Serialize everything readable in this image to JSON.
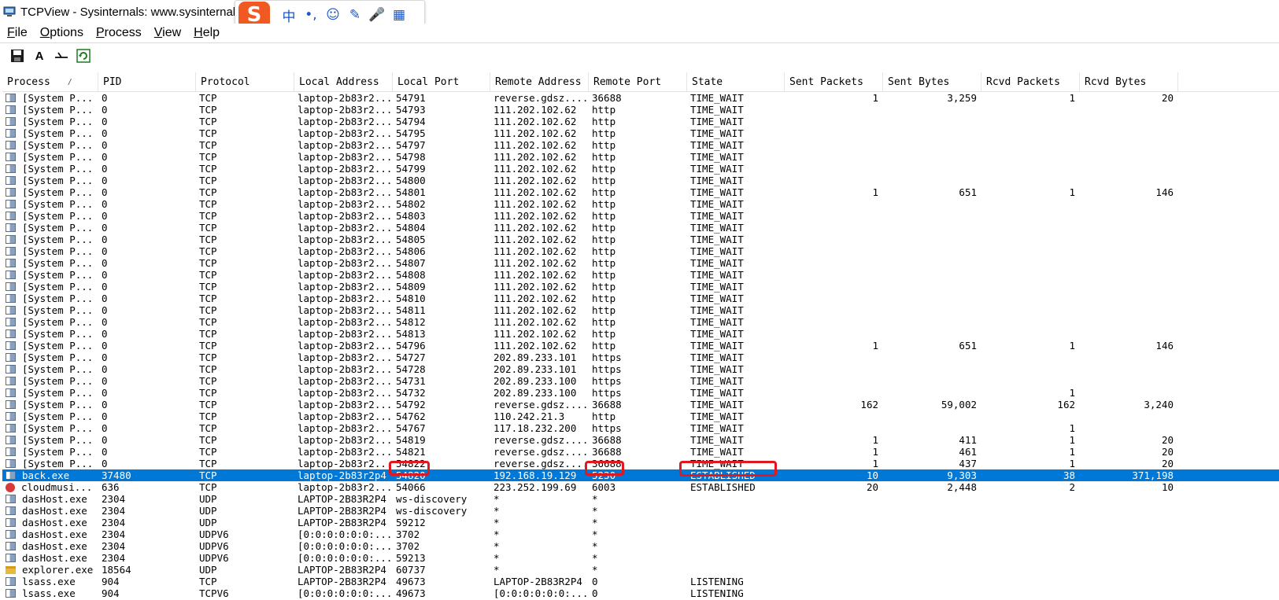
{
  "window": {
    "title": "TCPView - Sysinternals: www.sysinternals.com"
  },
  "ime": {
    "logo": "S",
    "buttons": [
      {
        "name": "chinese-mode-icon",
        "glyph": "中"
      },
      {
        "name": "punctuation-icon",
        "glyph": "•,"
      },
      {
        "name": "emoji-icon",
        "glyph": "☺"
      },
      {
        "name": "handwriting-icon",
        "glyph": "✎"
      },
      {
        "name": "microphone-icon",
        "glyph": "🎤"
      },
      {
        "name": "toolbox-icon",
        "glyph": "▦"
      }
    ]
  },
  "menu": [
    {
      "m": "F",
      "rest": "ile"
    },
    {
      "m": "O",
      "rest": "ptions"
    },
    {
      "m": "P",
      "rest": "rocess"
    },
    {
      "m": "V",
      "rest": "iew"
    },
    {
      "m": "H",
      "rest": "elp"
    }
  ],
  "toolbar": {
    "save_glyph": "💾",
    "font_glyph": "A",
    "connect_glyph": "⤙",
    "refresh_glyph": "⟳"
  },
  "columns": [
    "Process",
    "PID",
    "Protocol",
    "Local Address",
    "Local Port",
    "Remote Address",
    "Remote Port",
    "State",
    "Sent Packets",
    "Sent Bytes",
    "Rcvd Packets",
    "Rcvd Bytes"
  ],
  "sort_indicator": "/",
  "rows": [
    {
      "icon": "std",
      "c": [
        "[System P...",
        "0",
        "TCP",
        "laptop-2b83r2...",
        "54791",
        "reverse.gdsz....",
        "36688",
        "TIME_WAIT",
        "1",
        "3,259",
        "1",
        "20"
      ]
    },
    {
      "icon": "std",
      "c": [
        "[System P...",
        "0",
        "TCP",
        "laptop-2b83r2...",
        "54793",
        "111.202.102.62",
        "http",
        "TIME_WAIT",
        "",
        "",
        "",
        ""
      ]
    },
    {
      "icon": "std",
      "c": [
        "[System P...",
        "0",
        "TCP",
        "laptop-2b83r2...",
        "54794",
        "111.202.102.62",
        "http",
        "TIME_WAIT",
        "",
        "",
        "",
        ""
      ]
    },
    {
      "icon": "std",
      "c": [
        "[System P...",
        "0",
        "TCP",
        "laptop-2b83r2...",
        "54795",
        "111.202.102.62",
        "http",
        "TIME_WAIT",
        "",
        "",
        "",
        ""
      ]
    },
    {
      "icon": "std",
      "c": [
        "[System P...",
        "0",
        "TCP",
        "laptop-2b83r2...",
        "54797",
        "111.202.102.62",
        "http",
        "TIME_WAIT",
        "",
        "",
        "",
        ""
      ]
    },
    {
      "icon": "std",
      "c": [
        "[System P...",
        "0",
        "TCP",
        "laptop-2b83r2...",
        "54798",
        "111.202.102.62",
        "http",
        "TIME_WAIT",
        "",
        "",
        "",
        ""
      ]
    },
    {
      "icon": "std",
      "c": [
        "[System P...",
        "0",
        "TCP",
        "laptop-2b83r2...",
        "54799",
        "111.202.102.62",
        "http",
        "TIME_WAIT",
        "",
        "",
        "",
        ""
      ]
    },
    {
      "icon": "std",
      "c": [
        "[System P...",
        "0",
        "TCP",
        "laptop-2b83r2...",
        "54800",
        "111.202.102.62",
        "http",
        "TIME_WAIT",
        "",
        "",
        "",
        ""
      ]
    },
    {
      "icon": "std",
      "c": [
        "[System P...",
        "0",
        "TCP",
        "laptop-2b83r2...",
        "54801",
        "111.202.102.62",
        "http",
        "TIME_WAIT",
        "1",
        "651",
        "1",
        "146"
      ]
    },
    {
      "icon": "std",
      "c": [
        "[System P...",
        "0",
        "TCP",
        "laptop-2b83r2...",
        "54802",
        "111.202.102.62",
        "http",
        "TIME_WAIT",
        "",
        "",
        "",
        ""
      ]
    },
    {
      "icon": "std",
      "c": [
        "[System P...",
        "0",
        "TCP",
        "laptop-2b83r2...",
        "54803",
        "111.202.102.62",
        "http",
        "TIME_WAIT",
        "",
        "",
        "",
        ""
      ]
    },
    {
      "icon": "std",
      "c": [
        "[System P...",
        "0",
        "TCP",
        "laptop-2b83r2...",
        "54804",
        "111.202.102.62",
        "http",
        "TIME_WAIT",
        "",
        "",
        "",
        ""
      ]
    },
    {
      "icon": "std",
      "c": [
        "[System P...",
        "0",
        "TCP",
        "laptop-2b83r2...",
        "54805",
        "111.202.102.62",
        "http",
        "TIME_WAIT",
        "",
        "",
        "",
        ""
      ]
    },
    {
      "icon": "std",
      "c": [
        "[System P...",
        "0",
        "TCP",
        "laptop-2b83r2...",
        "54806",
        "111.202.102.62",
        "http",
        "TIME_WAIT",
        "",
        "",
        "",
        ""
      ]
    },
    {
      "icon": "std",
      "c": [
        "[System P...",
        "0",
        "TCP",
        "laptop-2b83r2...",
        "54807",
        "111.202.102.62",
        "http",
        "TIME_WAIT",
        "",
        "",
        "",
        ""
      ]
    },
    {
      "icon": "std",
      "c": [
        "[System P...",
        "0",
        "TCP",
        "laptop-2b83r2...",
        "54808",
        "111.202.102.62",
        "http",
        "TIME_WAIT",
        "",
        "",
        "",
        ""
      ]
    },
    {
      "icon": "std",
      "c": [
        "[System P...",
        "0",
        "TCP",
        "laptop-2b83r2...",
        "54809",
        "111.202.102.62",
        "http",
        "TIME_WAIT",
        "",
        "",
        "",
        ""
      ]
    },
    {
      "icon": "std",
      "c": [
        "[System P...",
        "0",
        "TCP",
        "laptop-2b83r2...",
        "54810",
        "111.202.102.62",
        "http",
        "TIME_WAIT",
        "",
        "",
        "",
        ""
      ]
    },
    {
      "icon": "std",
      "c": [
        "[System P...",
        "0",
        "TCP",
        "laptop-2b83r2...",
        "54811",
        "111.202.102.62",
        "http",
        "TIME_WAIT",
        "",
        "",
        "",
        ""
      ]
    },
    {
      "icon": "std",
      "c": [
        "[System P...",
        "0",
        "TCP",
        "laptop-2b83r2...",
        "54812",
        "111.202.102.62",
        "http",
        "TIME_WAIT",
        "",
        "",
        "",
        ""
      ]
    },
    {
      "icon": "std",
      "c": [
        "[System P...",
        "0",
        "TCP",
        "laptop-2b83r2...",
        "54813",
        "111.202.102.62",
        "http",
        "TIME_WAIT",
        "",
        "",
        "",
        ""
      ]
    },
    {
      "icon": "std",
      "c": [
        "[System P...",
        "0",
        "TCP",
        "laptop-2b83r2...",
        "54796",
        "111.202.102.62",
        "http",
        "TIME_WAIT",
        "1",
        "651",
        "1",
        "146"
      ]
    },
    {
      "icon": "std",
      "c": [
        "[System P...",
        "0",
        "TCP",
        "laptop-2b83r2...",
        "54727",
        "202.89.233.101",
        "https",
        "TIME_WAIT",
        "",
        "",
        "",
        ""
      ]
    },
    {
      "icon": "std",
      "c": [
        "[System P...",
        "0",
        "TCP",
        "laptop-2b83r2...",
        "54728",
        "202.89.233.101",
        "https",
        "TIME_WAIT",
        "",
        "",
        "",
        ""
      ]
    },
    {
      "icon": "std",
      "c": [
        "[System P...",
        "0",
        "TCP",
        "laptop-2b83r2...",
        "54731",
        "202.89.233.100",
        "https",
        "TIME_WAIT",
        "",
        "",
        "",
        ""
      ]
    },
    {
      "icon": "std",
      "c": [
        "[System P...",
        "0",
        "TCP",
        "laptop-2b83r2...",
        "54732",
        "202.89.233.100",
        "https",
        "TIME_WAIT",
        "",
        "",
        "1",
        ""
      ]
    },
    {
      "icon": "std",
      "c": [
        "[System P...",
        "0",
        "TCP",
        "laptop-2b83r2...",
        "54792",
        "reverse.gdsz....",
        "36688",
        "TIME_WAIT",
        "162",
        "59,002",
        "162",
        "3,240"
      ]
    },
    {
      "icon": "std",
      "c": [
        "[System P...",
        "0",
        "TCP",
        "laptop-2b83r2...",
        "54762",
        "110.242.21.3",
        "http",
        "TIME_WAIT",
        "",
        "",
        "",
        ""
      ]
    },
    {
      "icon": "std",
      "c": [
        "[System P...",
        "0",
        "TCP",
        "laptop-2b83r2...",
        "54767",
        "117.18.232.200",
        "https",
        "TIME_WAIT",
        "",
        "",
        "1",
        ""
      ]
    },
    {
      "icon": "std",
      "c": [
        "[System P...",
        "0",
        "TCP",
        "laptop-2b83r2...",
        "54819",
        "reverse.gdsz....",
        "36688",
        "TIME_WAIT",
        "1",
        "411",
        "1",
        "20"
      ]
    },
    {
      "icon": "std",
      "c": [
        "[System P...",
        "0",
        "TCP",
        "laptop-2b83r2...",
        "54821",
        "reverse.gdsz....",
        "36688",
        "TIME_WAIT",
        "1",
        "461",
        "1",
        "20"
      ]
    },
    {
      "icon": "std",
      "c": [
        "[System P...",
        "0",
        "TCP",
        "laptop-2b83r2...",
        "54822",
        "reverse.gdsz....",
        "36688",
        "TIME_WAIT",
        "1",
        "437",
        "1",
        "20"
      ]
    },
    {
      "icon": "std",
      "selected": true,
      "c": [
        "back.exe",
        "37480",
        "TCP",
        "laptop-2b83r2p4",
        "54820",
        "192.168.19.129",
        "5230",
        "ESTABLISHED",
        "10",
        "9,303",
        "38",
        "371,198"
      ]
    },
    {
      "icon": "cloud",
      "c": [
        "cloudmusi...",
        "636",
        "TCP",
        "laptop-2b83r2...",
        "54066",
        "223.252.199.69",
        "6003",
        "ESTABLISHED",
        "20",
        "2,448",
        "2",
        "10"
      ]
    },
    {
      "icon": "std",
      "c": [
        "dasHost.exe",
        "2304",
        "UDP",
        "LAPTOP-2B83R2P4",
        "ws-discovery",
        "*",
        "*",
        "",
        "",
        "",
        "",
        ""
      ]
    },
    {
      "icon": "std",
      "c": [
        "dasHost.exe",
        "2304",
        "UDP",
        "LAPTOP-2B83R2P4",
        "ws-discovery",
        "*",
        "*",
        "",
        "",
        "",
        "",
        ""
      ]
    },
    {
      "icon": "std",
      "c": [
        "dasHost.exe",
        "2304",
        "UDP",
        "LAPTOP-2B83R2P4",
        "59212",
        "*",
        "*",
        "",
        "",
        "",
        "",
        ""
      ]
    },
    {
      "icon": "std",
      "c": [
        "dasHost.exe",
        "2304",
        "UDPV6",
        "[0:0:0:0:0:0:...",
        "3702",
        "*",
        "*",
        "",
        "",
        "",
        "",
        ""
      ]
    },
    {
      "icon": "std",
      "c": [
        "dasHost.exe",
        "2304",
        "UDPV6",
        "[0:0:0:0:0:0:...",
        "3702",
        "*",
        "*",
        "",
        "",
        "",
        "",
        ""
      ]
    },
    {
      "icon": "std",
      "c": [
        "dasHost.exe",
        "2304",
        "UDPV6",
        "[0:0:0:0:0:0:...",
        "59213",
        "*",
        "*",
        "",
        "",
        "",
        "",
        ""
      ]
    },
    {
      "icon": "folder",
      "c": [
        "explorer.exe",
        "18564",
        "UDP",
        "LAPTOP-2B83R2P4",
        "60737",
        "*",
        "*",
        "",
        "",
        "",
        "",
        ""
      ]
    },
    {
      "icon": "std",
      "c": [
        "lsass.exe",
        "904",
        "TCP",
        "LAPTOP-2B83R2P4",
        "49673",
        "LAPTOP-2B83R2P4",
        "0",
        "LISTENING",
        "",
        "",
        "",
        ""
      ]
    },
    {
      "icon": "std",
      "c": [
        "lsass.exe",
        "904",
        "TCPV6",
        "[0:0:0:0:0:0:...",
        "49673",
        "[0:0:0:0:0:0:...",
        "0",
        "LISTENING",
        "",
        "",
        "",
        ""
      ]
    }
  ]
}
